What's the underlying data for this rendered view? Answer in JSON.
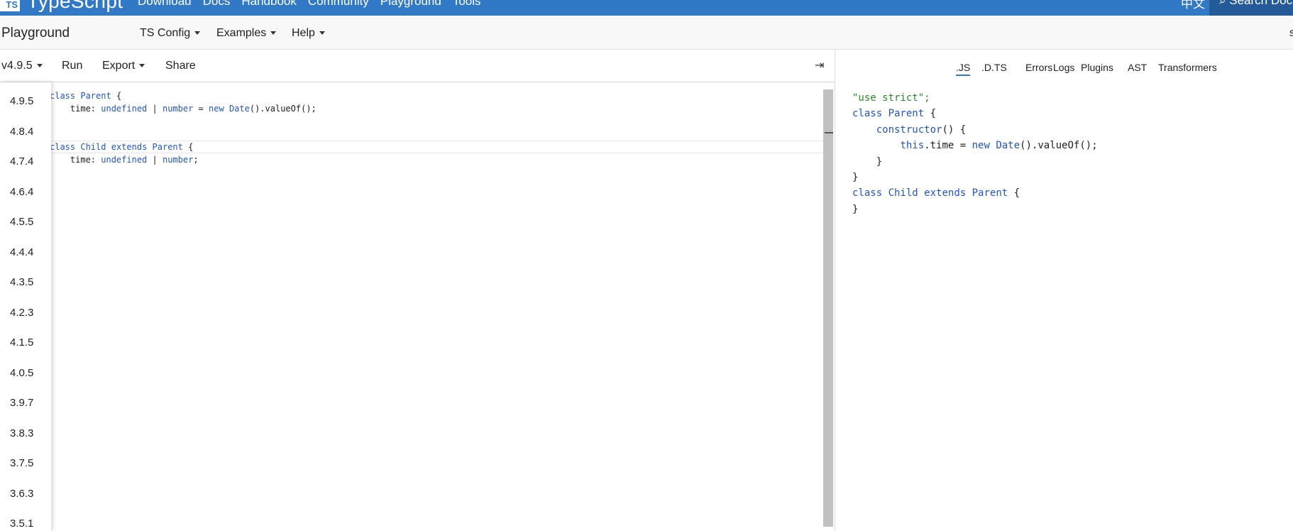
{
  "topnav": {
    "logo_box": "TS",
    "logo_text": "TypeScript",
    "links": [
      "Download",
      "Docs",
      "Handbook",
      "Community",
      "Playground",
      "Tools"
    ],
    "lang": "中文",
    "search": "Search Doc"
  },
  "subbar": {
    "title": "Playground",
    "menus": [
      "TS Config",
      "Examples",
      "Help"
    ],
    "right_char": "s"
  },
  "editor_toolbar": {
    "version": "v4.9.5",
    "run": "Run",
    "export": "Export",
    "share": "Share",
    "collapse_icon": "⇥"
  },
  "versions": [
    "4.9.5",
    "4.8.4",
    "4.7.4",
    "4.6.4",
    "4.5.5",
    "4.4.4",
    "4.3.5",
    "4.2.3",
    "4.1.5",
    "4.0.5",
    "3.9.7",
    "3.8.3",
    "3.7.5",
    "3.6.3",
    "3.5.1"
  ],
  "editor_code": {
    "l1": {
      "a": "class ",
      "b": "Parent",
      "c": " {"
    },
    "l2": {
      "a": "    time: ",
      "b": "undefined",
      "c": " | ",
      "d": "number",
      "e": " = ",
      "f": "new",
      "g": " ",
      "h": "Date",
      "i": "().valueOf();"
    },
    "l4": {
      "a": "class ",
      "b": "Child",
      "c": " ",
      "d": "extends",
      "e": " ",
      "f": "Parent",
      "g": " {"
    },
    "l5": {
      "a": "    time: ",
      "b": "undefined",
      "c": " | ",
      "d": "number",
      "e": ";"
    }
  },
  "output_tabs": [
    ".JS",
    ".D.TS",
    "Errors",
    "Logs",
    "Plugins",
    "AST",
    "Transformers"
  ],
  "output_code": {
    "l1": "\"use strict\";",
    "l2": {
      "a": "class ",
      "b": "Parent",
      "c": " {"
    },
    "l3": {
      "a": "    ",
      "b": "constructor",
      "c": "() {"
    },
    "l4": {
      "a": "        ",
      "b": "this",
      "c": ".time = ",
      "d": "new",
      "e": " ",
      "f": "Date",
      "g": "().valueOf();"
    },
    "l5": "    }",
    "l6": "}",
    "l7": {
      "a": "class ",
      "b": "Child",
      "c": " ",
      "d": "extends",
      "e": " ",
      "f": "Parent",
      "g": " {"
    },
    "l8": "}"
  }
}
